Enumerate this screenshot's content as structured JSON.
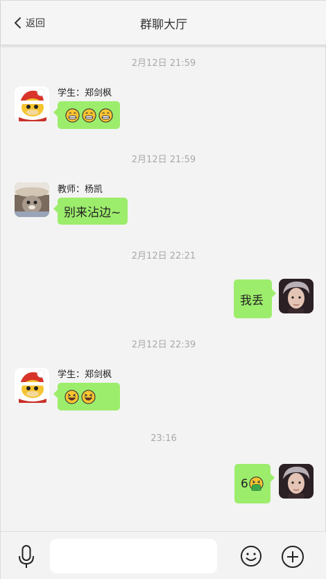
{
  "header": {
    "back_label": "返回",
    "title": "群聊大厅"
  },
  "messages": [
    {
      "time": "2月12日 21:59",
      "side": "left",
      "sender": "学生：郑剑枫",
      "avatar": "duck-santa-avatar",
      "text": "",
      "emojis": [
        "grin-icon",
        "grin-icon",
        "grin-icon"
      ]
    },
    {
      "time": "2月12日 21:59",
      "side": "left",
      "sender": "教师：杨凯",
      "avatar": "cat-hat-avatar",
      "text": "别来沾边~",
      "emojis": []
    },
    {
      "time": "2月12日 22:21",
      "side": "right",
      "sender": "",
      "avatar": "silver-hair-avatar",
      "text": "我丢",
      "emojis": []
    },
    {
      "time": "2月12日 22:39",
      "side": "left",
      "sender": "学生：郑剑枫",
      "avatar": "duck-santa-avatar",
      "text": "",
      "emojis": [
        "squint-laugh-icon",
        "squint-laugh-icon"
      ]
    },
    {
      "time": "23:16",
      "side": "right",
      "sender": "",
      "avatar": "silver-hair-avatar",
      "text": "6",
      "emojis": [
        "vomit-icon"
      ]
    }
  ],
  "composer": {
    "input_value": "",
    "input_placeholder": ""
  },
  "colors": {
    "bubble": "#9ded6c",
    "background": "#f3f3f3",
    "timestamp": "#a9a9a9"
  }
}
